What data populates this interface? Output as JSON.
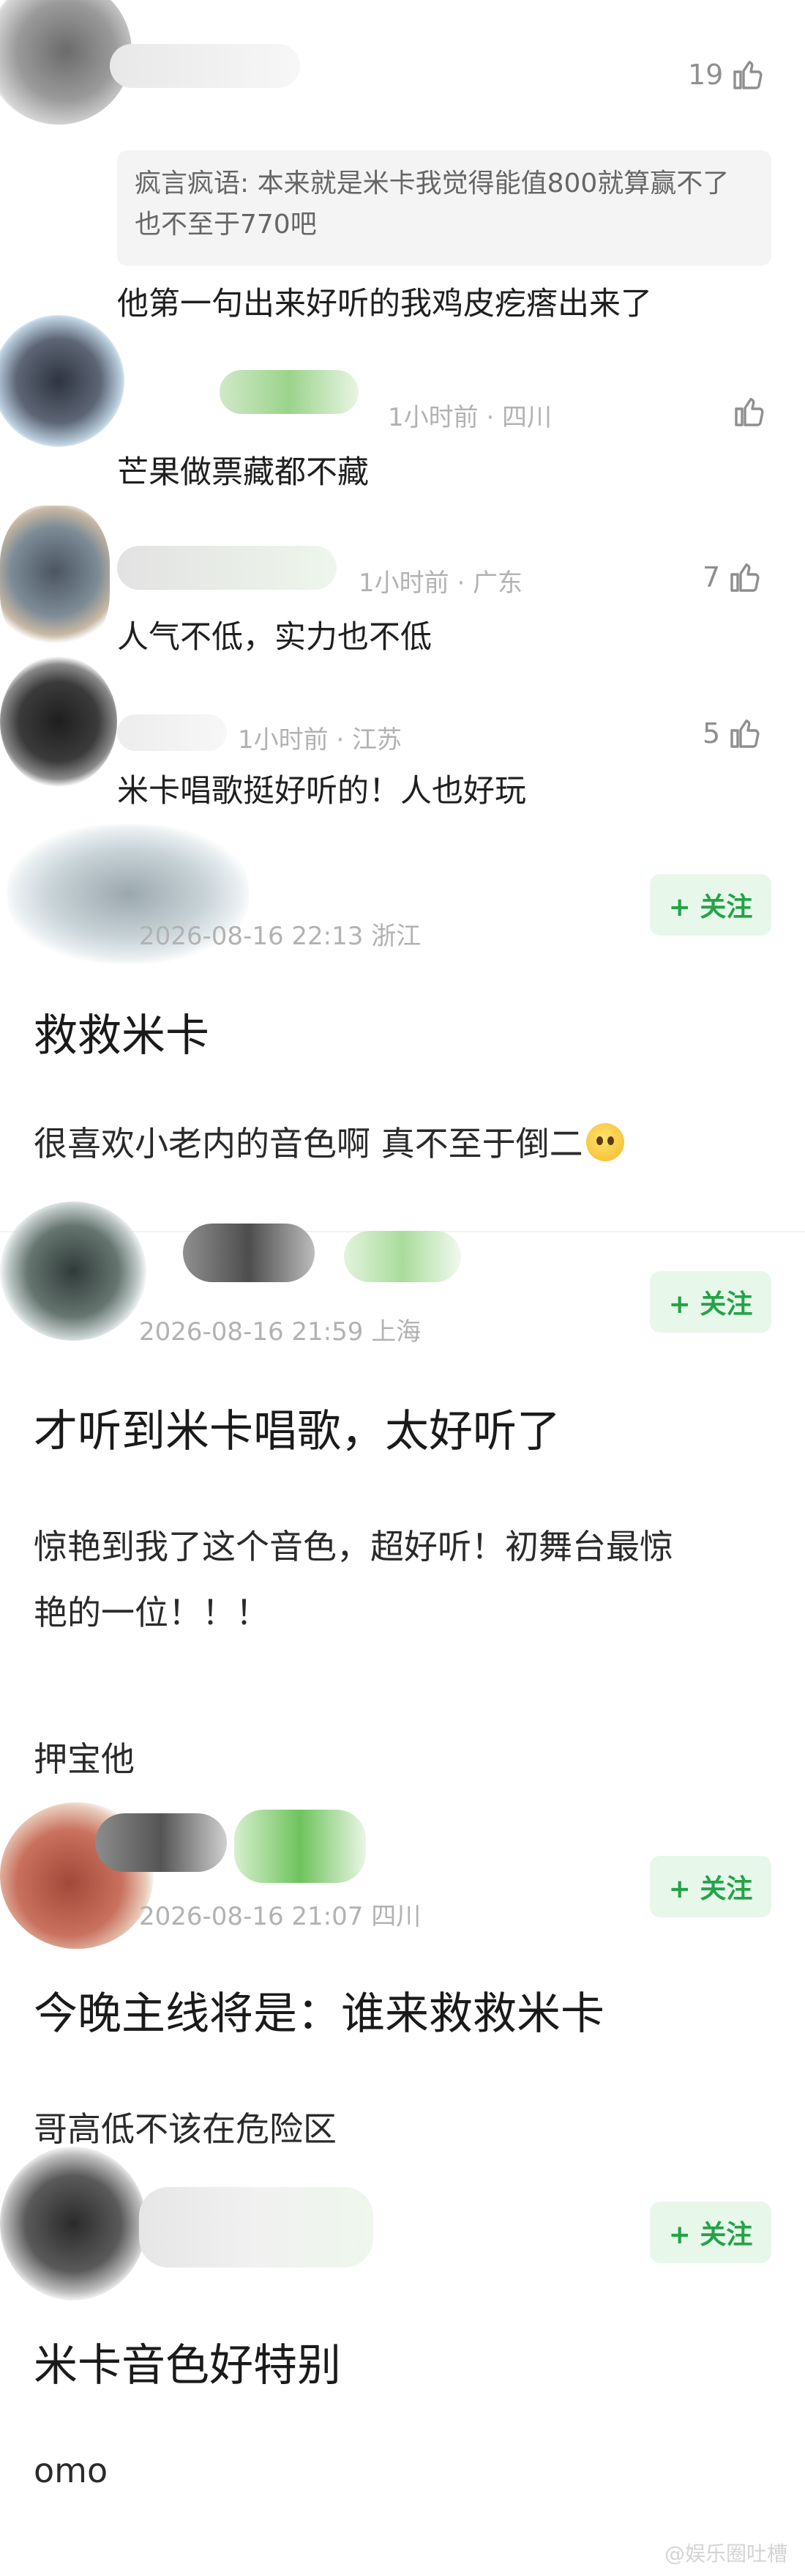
{
  "comments": [
    {
      "meta": "",
      "text": "他第一句出来好听的我鸡皮疙瘩出来了",
      "likes": "19",
      "quote": "疯言疯语: 本来就是米卡我觉得能值800就算赢不了也不至于770吧"
    },
    {
      "meta": "1小时前 · 四川",
      "text": "芒果做票藏都不藏",
      "likes": ""
    },
    {
      "meta": "1小时前 · 广东",
      "text": "人气不低，实力也不低",
      "likes": "7"
    },
    {
      "meta": "1小时前 · 江苏",
      "text": "米卡唱歌挺好听的！人也好玩",
      "likes": "5"
    }
  ],
  "follow_label": "+ 关注",
  "posts": [
    {
      "meta": "2026-08-16 22:13  浙江",
      "title": "救救米卡",
      "body": [
        "很喜欢小老内的音色啊 真不至于倒二"
      ]
    },
    {
      "meta": "2026-08-16 21:59  上海",
      "title": "才听到米卡唱歌，太好听了",
      "body": [
        "惊艳到我了这个音色，超好听！初舞台最惊",
        "艳的一位！！！",
        "押宝他"
      ]
    },
    {
      "meta": "2026-08-16 21:07  四川",
      "title": "今晚主线将是：谁来救救米卡",
      "body": [
        "哥高低不该在危险区"
      ]
    },
    {
      "meta": "",
      "title": "米卡音色好特别",
      "body": [
        "omo"
      ]
    }
  ],
  "watermark": "@娱乐圈吐槽"
}
